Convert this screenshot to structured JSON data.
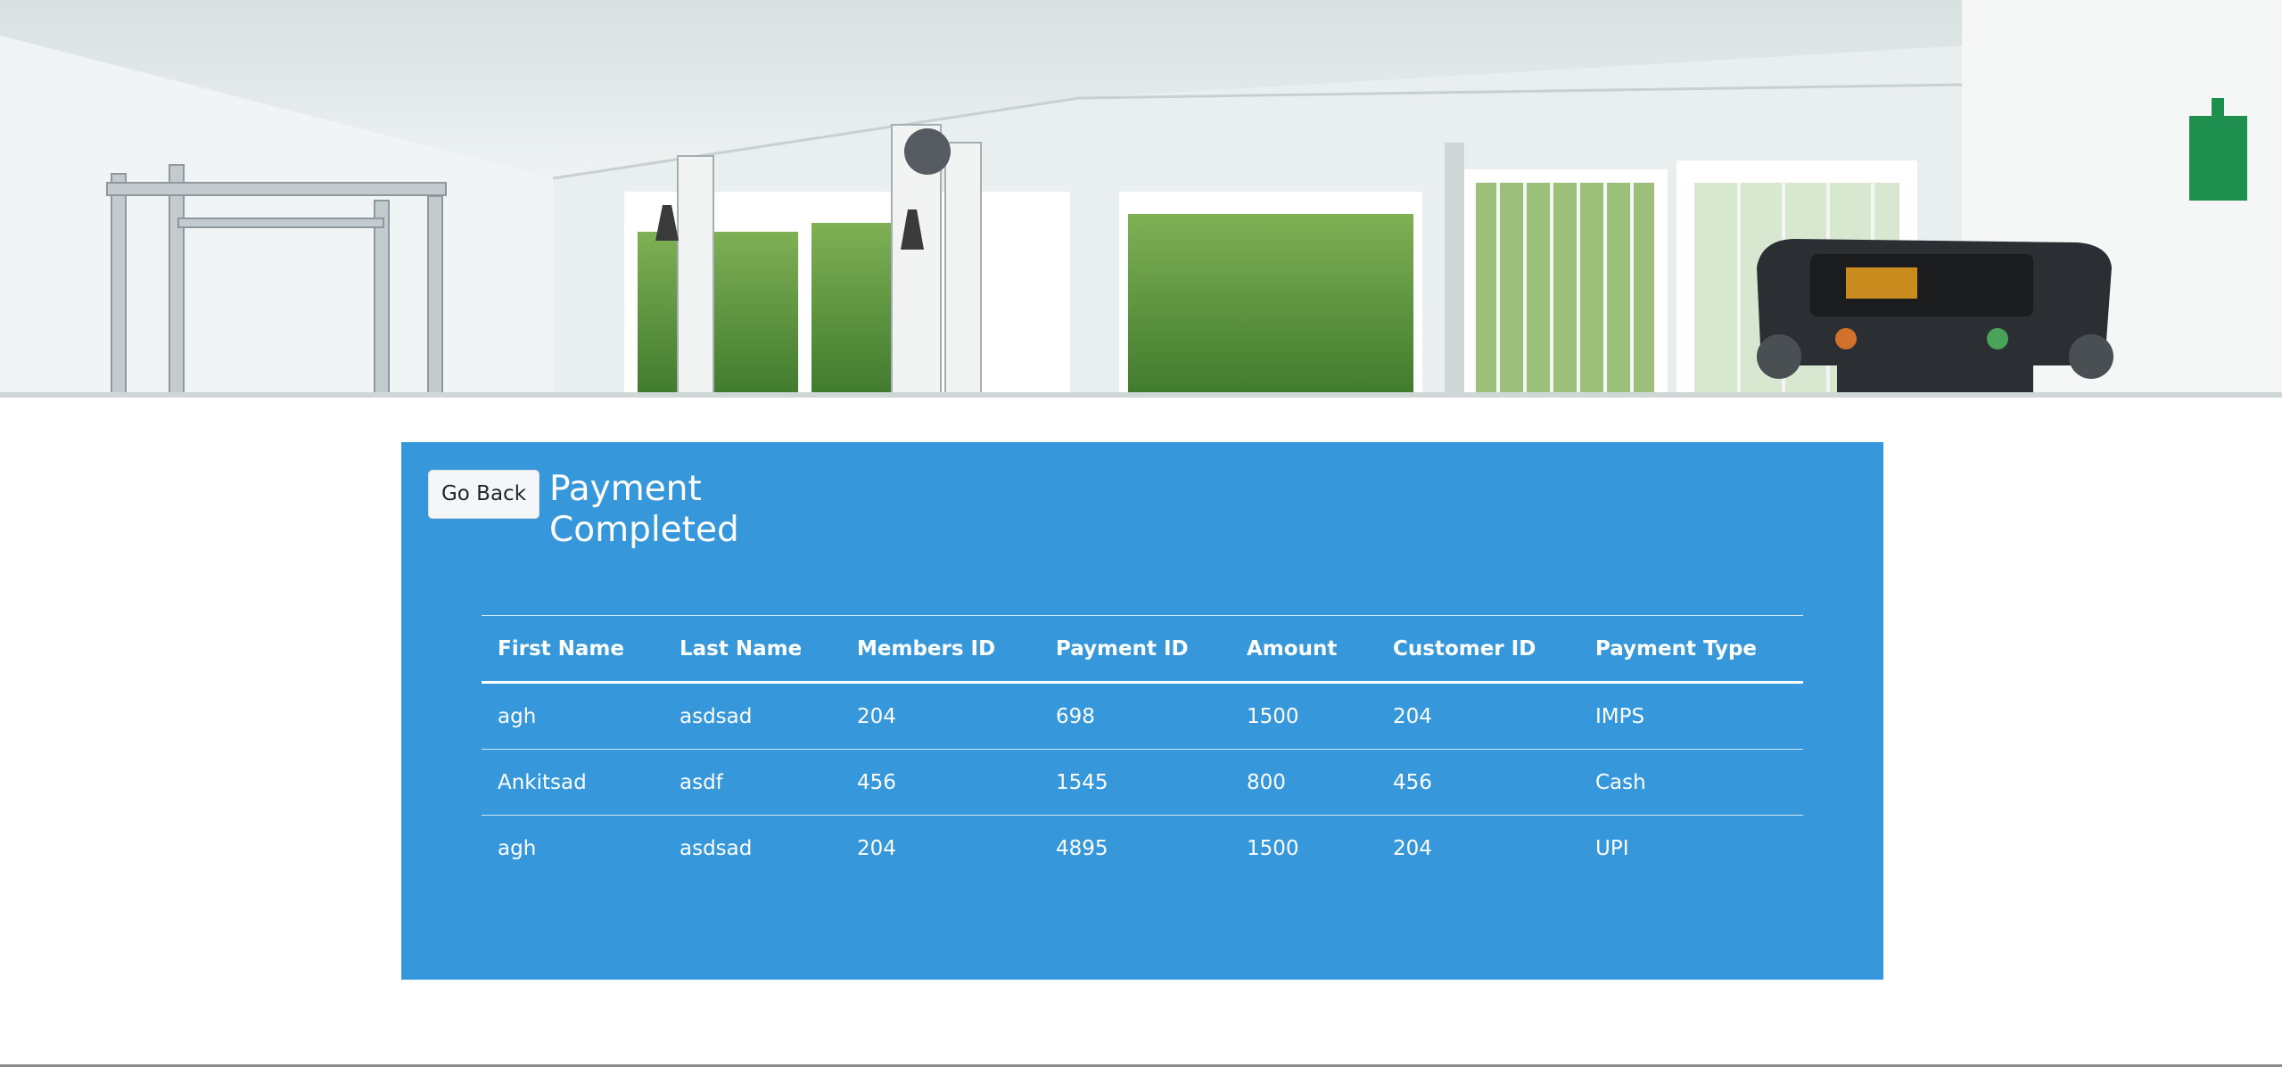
{
  "hero": {
    "image_icon": "gym-interior-photo",
    "treadmill_icon": "treadmill-icon",
    "first_aid_icon": "first-aid-kit-icon"
  },
  "panel": {
    "back_label": "Go Back",
    "title": "Payment Completed",
    "background_color": "#3698db"
  },
  "table": {
    "headers": [
      "First Name",
      "Last Name",
      "Members ID",
      "Payment ID",
      "Amount",
      "Customer ID",
      "Payment Type"
    ],
    "rows": [
      [
        "agh",
        "asdsad",
        "204",
        "698",
        "1500",
        "204",
        "IMPS"
      ],
      [
        "Ankitsad",
        "asdf",
        "456",
        "1545",
        "800",
        "456",
        "Cash"
      ],
      [
        "agh",
        "asdsad",
        "204",
        "4895",
        "1500",
        "204",
        "UPI"
      ]
    ]
  }
}
